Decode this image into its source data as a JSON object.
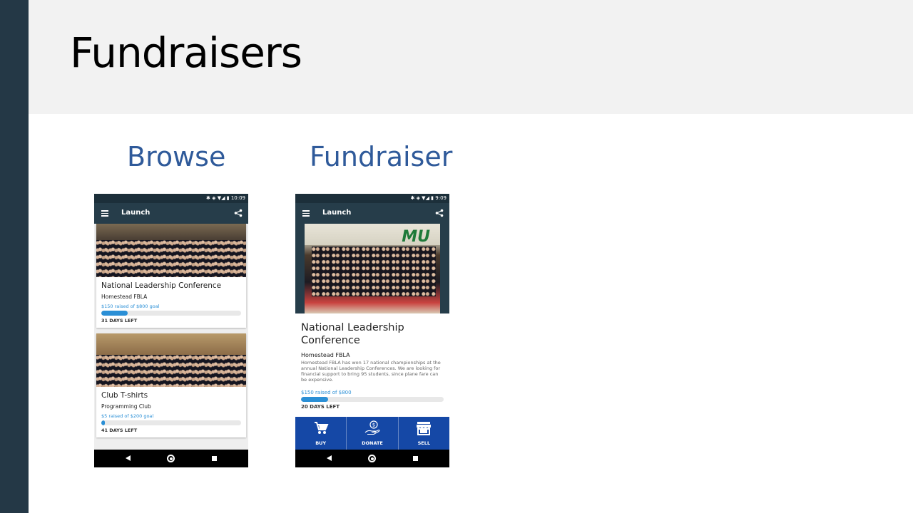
{
  "slide": {
    "title": "Fundraisers",
    "accent_color": "#2f5a9a",
    "sidebar_color": "#243846"
  },
  "browse": {
    "label": "Browse",
    "status_time": "10:09",
    "app_title": "Launch",
    "cards": [
      {
        "title": "National Leadership Conference",
        "org": "Homestead FBLA",
        "raised": "$150 raised of $800 goal",
        "progress_fraction": 0.19,
        "days_left": "31 DAYS LEFT"
      },
      {
        "title": "Club T-shirts",
        "org": "Programming Club",
        "raised": "$5 raised of $200 goal",
        "progress_fraction": 0.025,
        "days_left": "41 DAYS LEFT"
      }
    ]
  },
  "fundraiser": {
    "label": "Fundraiser",
    "status_time": "9:09",
    "app_title": "Launch",
    "banner_text": "MU",
    "title": "National Leadership Conference",
    "org": "Homestead FBLA",
    "description": "Homestead FBLA has won 17 national championships at the annual National Leadership Conferences. We are looking for financial support to bring 95 students, since plane fare can be expensive.",
    "raised": "$150 raised of $800",
    "progress_fraction": 0.19,
    "days_left": "20 DAYS LEFT",
    "actions": [
      {
        "label": "BUY",
        "icon": "cart-icon"
      },
      {
        "label": "DONATE",
        "icon": "donate-hand-icon"
      },
      {
        "label": "SELL",
        "icon": "storefront-icon"
      }
    ],
    "action_bar_color": "#1548a6"
  }
}
